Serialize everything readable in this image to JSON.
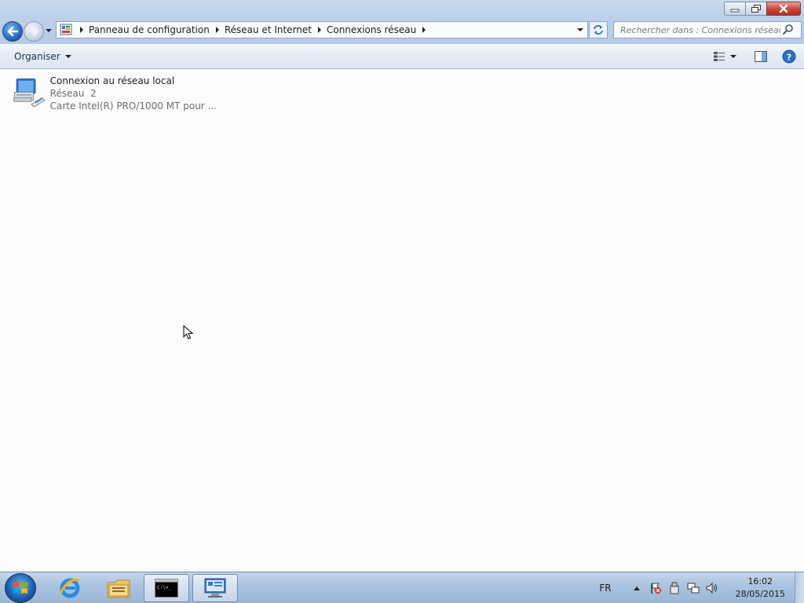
{
  "window": {
    "caption_buttons": [
      "minimize-icon",
      "restore-icon",
      "close-icon"
    ]
  },
  "address": {
    "crumbs": [
      "Panneau de configuration",
      "Réseau et Internet",
      "Connexions réseau"
    ]
  },
  "search": {
    "placeholder": "Rechercher dans : Connexions réseau"
  },
  "toolbar": {
    "organize_label": "Organiser"
  },
  "items": [
    {
      "name": "Connexion au réseau local",
      "network": "Réseau  2",
      "adapter": "Carte Intel(R) PRO/1000 MT pour ..."
    }
  ],
  "taskbar": {
    "apps": [
      "internet-explorer-icon",
      "file-explorer-icon",
      "command-prompt-icon",
      "network-connections-icon"
    ],
    "language": "FR",
    "time": "16:02",
    "date": "28/05/2015"
  },
  "colors": {
    "accent": "#1e5fb5",
    "close": "#c6443a",
    "taskbar": "#aac3df"
  }
}
